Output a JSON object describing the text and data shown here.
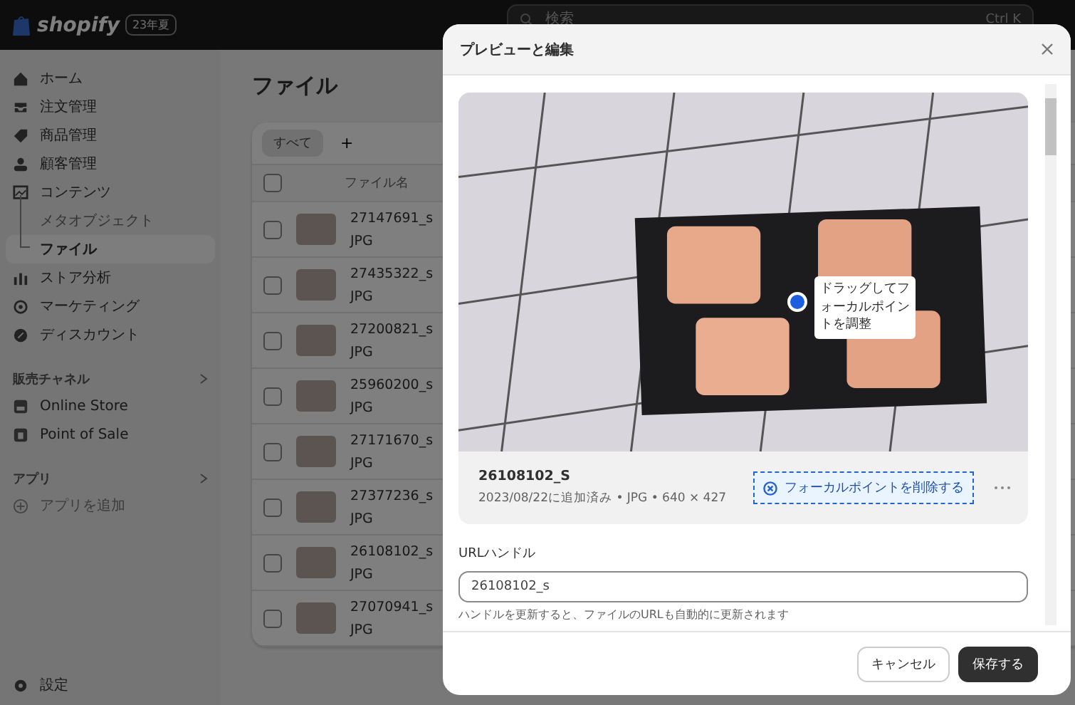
{
  "topbar": {
    "logo": "shopify",
    "badge": "23年夏",
    "search": {
      "placeholder": "検索",
      "shortcut": "Ctrl K"
    }
  },
  "sidebar": {
    "items": [
      {
        "label": "ホーム",
        "kind": "home",
        "selected": false
      },
      {
        "label": "注文管理",
        "kind": "inbox",
        "selected": false
      },
      {
        "label": "商品管理",
        "kind": "tag",
        "selected": false
      },
      {
        "label": "顧客管理",
        "kind": "person",
        "selected": false
      },
      {
        "label": "コンテンツ",
        "kind": "image",
        "selected": false,
        "children": [
          {
            "label": "メタオブジェクト",
            "selected": false
          },
          {
            "label": "ファイル",
            "selected": true
          }
        ]
      },
      {
        "label": "ストア分析",
        "kind": "bars",
        "selected": false
      },
      {
        "label": "マーケティング",
        "kind": "target",
        "selected": false
      },
      {
        "label": "ディスカウント",
        "kind": "badge",
        "selected": false
      }
    ],
    "sections": [
      {
        "title": "販売チャネル",
        "items": [
          {
            "label": "Online Store",
            "kind": "store"
          },
          {
            "label": "Point of Sale",
            "kind": "bag"
          }
        ]
      },
      {
        "title": "アプリ",
        "items": [
          {
            "label": "アプリを追加",
            "kind": "plus"
          }
        ]
      }
    ],
    "settings": "設定"
  },
  "page": {
    "title": "ファイル",
    "tabs": [
      {
        "label": "すべて",
        "selected": true
      }
    ],
    "add_tab": "+",
    "table": {
      "checked": false,
      "columns": [
        "ファイル名"
      ],
      "rows": [
        {
          "name": "27147691_s",
          "type": "JPG",
          "checked": false
        },
        {
          "name": "27435322_s",
          "type": "JPG",
          "checked": false
        },
        {
          "name": "27200821_s",
          "type": "JPG",
          "checked": false
        },
        {
          "name": "25960200_s",
          "type": "JPG",
          "checked": false
        },
        {
          "name": "27171670_s",
          "type": "JPG",
          "checked": false
        },
        {
          "name": "27377236_s",
          "type": "JPG",
          "checked": false
        },
        {
          "name": "26108102_s",
          "type": "JPG",
          "checked": false
        },
        {
          "name": "27070941_s",
          "type": "JPG",
          "checked": false
        }
      ]
    }
  },
  "modal": {
    "title": "プレビューと編集",
    "tooltip": "ドラッグしてフォーカルポイントを調整",
    "file_name": "26108102_S",
    "meta": "2023/08/22に追加済み • JPG • 640 × 427",
    "focal_button": "フォーカルポイントを削除する",
    "url_label": "URLハンドル",
    "url_value": "26108102_s",
    "help": "ハンドルを更新すると、ファイルのURLも自動的に更新されます",
    "buttons": [
      {
        "label": "キャンセル",
        "kind": "secondary"
      },
      {
        "label": "保存する",
        "kind": "primary"
      }
    ]
  }
}
